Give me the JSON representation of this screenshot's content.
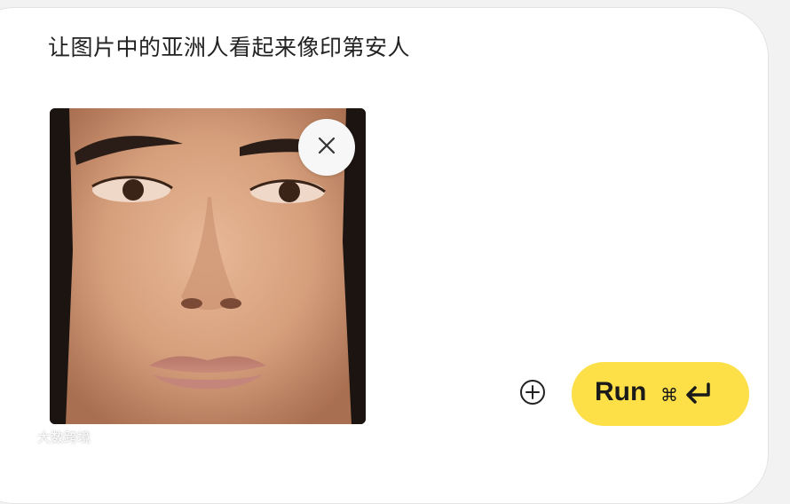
{
  "prompt": {
    "text": "让图片中的亚洲人看起来像印第安人"
  },
  "attachment": {
    "image_description_icon": "portrait-photo",
    "remove_icon": "close-icon"
  },
  "actions": {
    "add_icon": "plus-circle-icon",
    "run_label": "Run",
    "shortcut_cmd": "⌘",
    "shortcut_enter_icon": "return-arrow-icon"
  },
  "watermark": {
    "text": "大数跨境"
  },
  "colors": {
    "run_button": "#fde047",
    "card_background": "#ffffff",
    "page_background": "#f2f2f2",
    "text": "#222222"
  }
}
